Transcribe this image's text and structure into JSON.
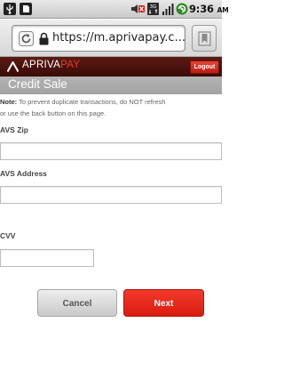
{
  "status_bar": {
    "time": "9:36",
    "ampm": "AM",
    "network": "3G",
    "icons": [
      "usb-icon",
      "sd-card-icon",
      "mute-icon",
      "network-3g-icon",
      "signal-icon",
      "battery-icon"
    ]
  },
  "browser": {
    "url": "https://m.aprivapay.c...",
    "icons": [
      "reload-icon",
      "lock-icon",
      "bookmark-icon"
    ]
  },
  "header": {
    "brand_part1": "APRIVA",
    "brand_part2": "PAY",
    "logout_label": "Logout"
  },
  "page": {
    "title": "Credit Sale",
    "note_label": "Note:",
    "note_line1_rest": " To prevent duplicate transactions, do NOT refresh",
    "note_line2": "or use the back button on this page."
  },
  "form": {
    "avs_zip_label": "AVS Zip",
    "avs_zip_value": "",
    "avs_address_label": "AVS Address",
    "avs_address_value": "",
    "cvv_label": "CVV",
    "cvv_value": ""
  },
  "buttons": {
    "cancel_label": "Cancel",
    "next_label": "Next"
  },
  "colors": {
    "header_bg": "#4a130d",
    "brand_accent": "#e63a2a",
    "next_button": "#e8281c",
    "title_bar": "#aaaaaa"
  }
}
